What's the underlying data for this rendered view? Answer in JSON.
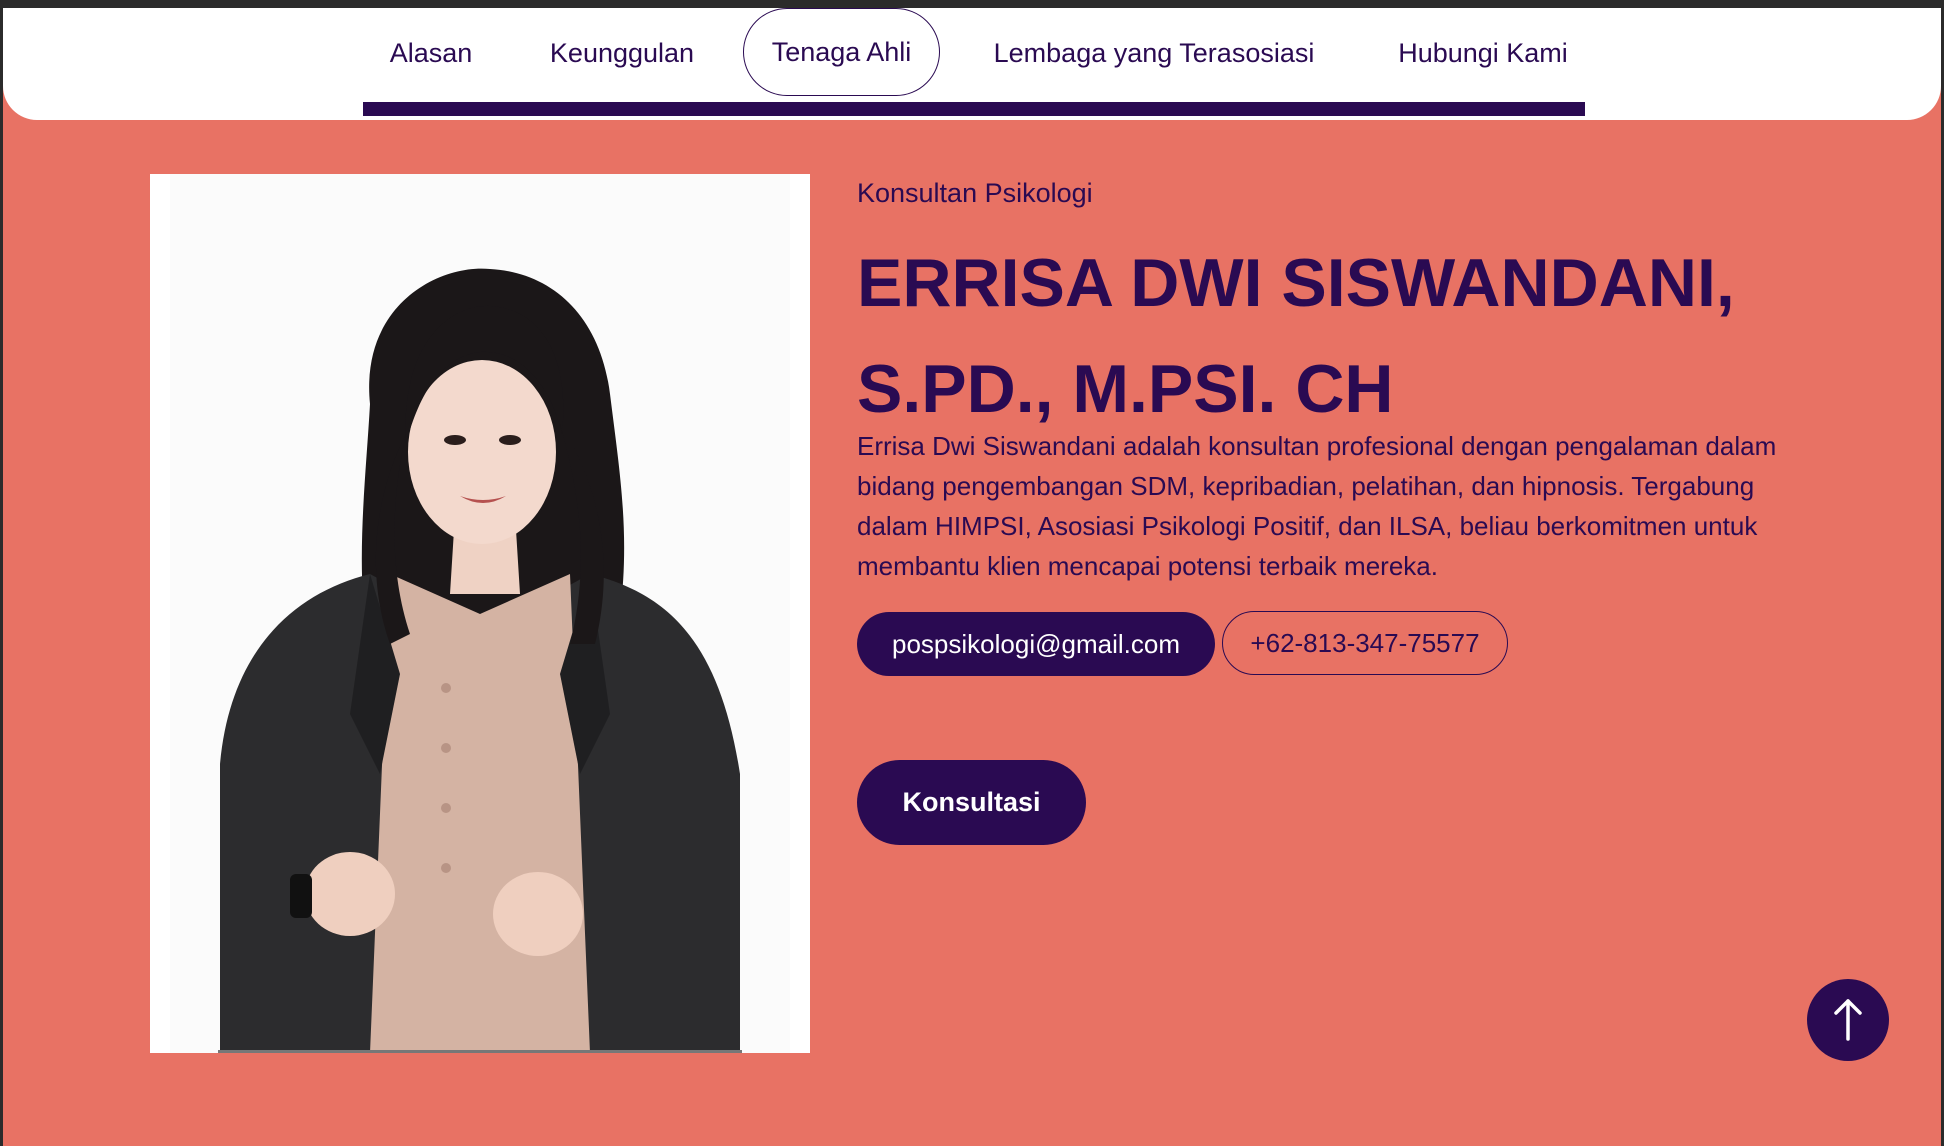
{
  "nav": {
    "items": [
      {
        "label": "Alasan"
      },
      {
        "label": "Keunggulan"
      },
      {
        "label": "Tenaga Ahli",
        "active": true
      },
      {
        "label": "Lembaga yang Terasosiasi"
      },
      {
        "label": "Hubungi Kami"
      }
    ]
  },
  "profile": {
    "role": "Konsultan Psikologi",
    "name_line1": "ERRISA DWI SISWANDANI,",
    "name_line2": "S.PD., M.PSI. CH",
    "bio": "Errisa Dwi Siswandani adalah konsultan profesional dengan pengalaman dalam bidang pengembangan SDM, kepribadian, pelatihan, dan hipnosis. Tergabung dalam HIMPSI, Asosiasi Psikologi Positif, dan ILSA, beliau berkomitmen untuk membantu klien mencapai potensi terbaik mereka.",
    "email": "pospsikologi@gmail.com",
    "phone": "+62-813-347-75577",
    "cta_label": "Konsultasi"
  },
  "icons": {
    "scroll_top": "arrow-up-icon"
  },
  "colors": {
    "background": "#e87264",
    "primary": "#2a0a52",
    "nav_bg": "#ffffff"
  }
}
